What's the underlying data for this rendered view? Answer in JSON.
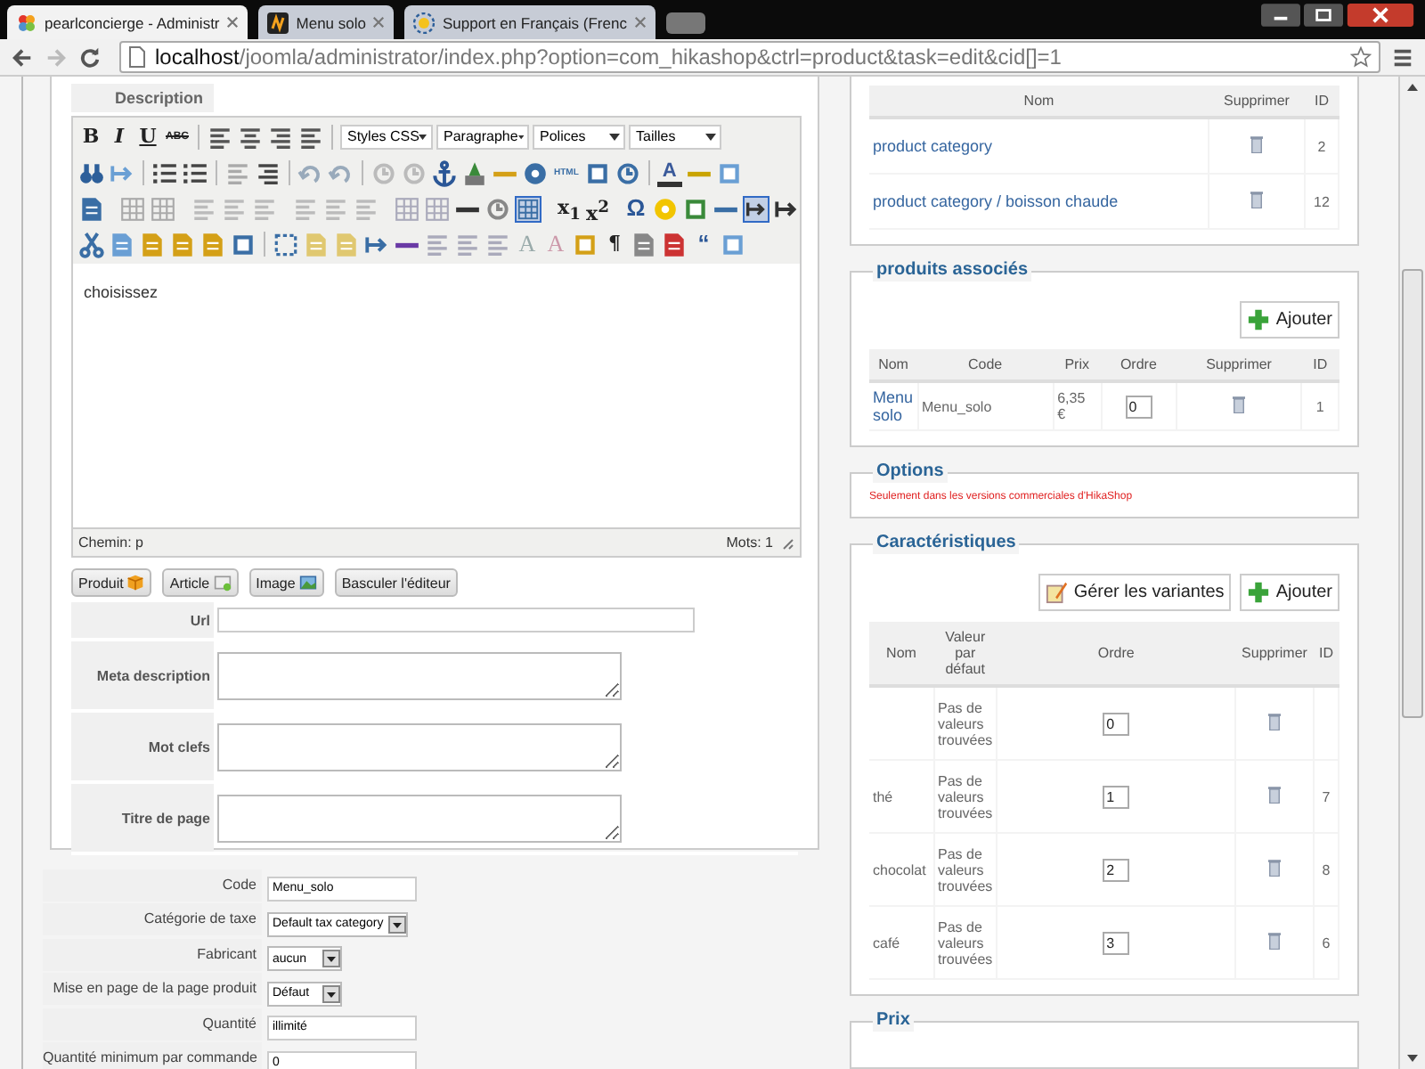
{
  "browser": {
    "tabs": [
      {
        "title": "pearlconcierge - Administr",
        "selected": true
      },
      {
        "title": "Menu solo",
        "selected": false
      },
      {
        "title": "Support en Français (Frenc",
        "selected": false
      }
    ],
    "url_host": "localhost",
    "url_path": "/joomla/administrator/index.php?option=com_hikashop&ctrl=product&task=edit&cid[]=1"
  },
  "description": {
    "label": "Description",
    "toolbar_rows": [
      [
        {
          "kind": "glyph",
          "text": "B",
          "active": false
        },
        {
          "kind": "glyph",
          "text": "I",
          "active": false
        },
        {
          "kind": "glyph",
          "text": "U",
          "active": false
        },
        {
          "kind": "glyph",
          "text": "ABC",
          "active": false
        },
        {
          "kind": "sep"
        },
        {
          "kind": "icon",
          "active": false
        },
        {
          "kind": "icon",
          "active": false
        },
        {
          "kind": "icon",
          "active": false
        },
        {
          "kind": "icon",
          "active": false
        },
        {
          "kind": "sep"
        },
        {
          "kind": "select",
          "text": "Styles CSS"
        },
        {
          "kind": "select",
          "text": "Paragraphe"
        },
        {
          "kind": "select",
          "text": "Polices"
        },
        {
          "kind": "select",
          "text": "Tailles"
        }
      ],
      [
        {
          "kind": "icon",
          "active": false
        },
        {
          "kind": "icon",
          "active": false
        },
        {
          "kind": "sep"
        },
        {
          "kind": "icon",
          "active": false
        },
        {
          "kind": "icon",
          "active": false
        },
        {
          "kind": "sep"
        },
        {
          "kind": "icon",
          "active": false
        },
        {
          "kind": "icon",
          "active": false
        },
        {
          "kind": "sep"
        },
        {
          "kind": "icon",
          "active": false
        },
        {
          "kind": "icon",
          "active": false
        },
        {
          "kind": "sep"
        },
        {
          "kind": "icon",
          "active": false
        },
        {
          "kind": "icon",
          "active": false
        },
        {
          "kind": "icon",
          "active": false
        },
        {
          "kind": "icon",
          "active": false
        },
        {
          "kind": "icon",
          "active": false
        },
        {
          "kind": "icon",
          "active": false
        },
        {
          "kind": "glyph",
          "text": "HTML",
          "active": false
        },
        {
          "kind": "icon",
          "active": false
        },
        {
          "kind": "icon",
          "active": false
        },
        {
          "kind": "sep"
        },
        {
          "kind": "glyph",
          "text": "A",
          "active": false
        },
        {
          "kind": "icon",
          "active": false
        },
        {
          "kind": "icon",
          "active": false
        }
      ],
      [
        {
          "kind": "icon",
          "active": false
        },
        {
          "kind": "sep"
        },
        {
          "kind": "icon",
          "active": false
        },
        {
          "kind": "icon",
          "active": false
        },
        {
          "kind": "sep"
        },
        {
          "kind": "icon",
          "active": false
        },
        {
          "kind": "icon",
          "active": false
        },
        {
          "kind": "icon",
          "active": false
        },
        {
          "kind": "sep"
        },
        {
          "kind": "icon",
          "active": false
        },
        {
          "kind": "icon",
          "active": false
        },
        {
          "kind": "icon",
          "active": false
        },
        {
          "kind": "sep"
        },
        {
          "kind": "icon",
          "active": false
        },
        {
          "kind": "icon",
          "active": false
        },
        {
          "kind": "icon",
          "active": false
        },
        {
          "kind": "icon",
          "active": false
        },
        {
          "kind": "icon",
          "active": true
        },
        {
          "kind": "sep"
        },
        {
          "kind": "glyph",
          "text": "x$_{1}$",
          "active": false
        },
        {
          "kind": "glyph",
          "text": "x$^{2}$",
          "active": false
        },
        {
          "kind": "sep"
        },
        {
          "kind": "glyph",
          "text": "Ω",
          "active": false
        },
        {
          "kind": "icon",
          "active": false
        },
        {
          "kind": "icon",
          "active": false
        },
        {
          "kind": "icon",
          "active": false
        },
        {
          "kind": "icon",
          "active": true
        },
        {
          "kind": "icon",
          "active": false
        }
      ],
      [
        {
          "kind": "icon",
          "active": false
        },
        {
          "kind": "icon",
          "active": false
        },
        {
          "kind": "icon",
          "active": false
        },
        {
          "kind": "icon",
          "active": false
        },
        {
          "kind": "icon",
          "active": false
        },
        {
          "kind": "icon",
          "active": false
        },
        {
          "kind": "sep"
        },
        {
          "kind": "icon",
          "active": false
        },
        {
          "kind": "icon",
          "active": false
        },
        {
          "kind": "icon",
          "active": false
        },
        {
          "kind": "icon",
          "active": false
        },
        {
          "kind": "icon",
          "active": false
        },
        {
          "kind": "icon",
          "active": false
        },
        {
          "kind": "icon",
          "active": false
        },
        {
          "kind": "icon",
          "active": false
        },
        {
          "kind": "glyph",
          "text": "A",
          "active": false
        },
        {
          "kind": "glyph",
          "text": "A",
          "active": false
        },
        {
          "kind": "icon",
          "active": false
        },
        {
          "kind": "glyph",
          "text": "¶",
          "active": false
        },
        {
          "kind": "icon",
          "active": false
        },
        {
          "kind": "icon",
          "active": false
        },
        {
          "kind": "glyph",
          "text": "“",
          "active": false
        },
        {
          "kind": "icon",
          "active": false
        }
      ]
    ],
    "content": "choisissez",
    "path": "Chemin: p",
    "word_count": "Mots: 1"
  },
  "editor_buttons": [
    "Produit",
    "Article",
    "Image",
    "Basculer l'éditeur"
  ],
  "seo_fields": [
    {
      "label": "Url",
      "kind": "line"
    },
    {
      "label": "Meta description",
      "kind": "area"
    },
    {
      "label": "Mot clefs",
      "kind": "area"
    },
    {
      "label": "Titre de page",
      "kind": "area"
    }
  ],
  "product_fields": [
    {
      "label": "Code",
      "kind": "text",
      "value": "Menu_solo"
    },
    {
      "label": "Catégorie de taxe",
      "kind": "select",
      "value": "Default tax category"
    },
    {
      "label": "Fabricant",
      "kind": "select",
      "value": "aucun"
    },
    {
      "label": "Mise en page de la page produit",
      "kind": "select",
      "value": "Défaut"
    },
    {
      "label": "Quantité",
      "kind": "text",
      "value": "illimité"
    },
    {
      "label": "Quantité minimum par commande",
      "kind": "text",
      "value": "0"
    }
  ],
  "categories": {
    "columns": [
      "Nom",
      "Supprimer",
      "ID"
    ],
    "rows": [
      {
        "name": "product category",
        "id": "2"
      },
      {
        "name": "product category / boisson chaude",
        "id": "12"
      }
    ]
  },
  "related": {
    "legend": "produits associés",
    "add_button": "Ajouter",
    "columns": [
      "Nom",
      "Code",
      "Prix",
      "Ordre",
      "Supprimer",
      "ID"
    ],
    "rows": [
      {
        "name": "Menu solo",
        "code": "Menu_solo",
        "price": "6,35 €",
        "order": "0",
        "id": "1"
      }
    ]
  },
  "options": {
    "legend": "Options",
    "notice": "Seulement dans les versions commerciales d'HikaShop"
  },
  "characteristics": {
    "legend": "Caractéristiques",
    "variants_button": "Gérer les variantes",
    "add_button": "Ajouter",
    "columns": [
      "Nom",
      "Valeur par défaut",
      "Ordre",
      "Supprimer",
      "ID"
    ],
    "rows": [
      {
        "default": "Pas de valeurs trouvées",
        "order": "0"
      },
      {
        "name": "thé",
        "default": "Pas de valeurs trouvées",
        "order": "1",
        "id": "7"
      },
      {
        "name": "chocolat",
        "default": "Pas de valeurs trouvées",
        "order": "2",
        "id": "8"
      },
      {
        "name": "café",
        "default": "Pas de valeurs trouvées",
        "order": "3",
        "id": "6"
      }
    ]
  },
  "price": {
    "legend": "Prix"
  }
}
